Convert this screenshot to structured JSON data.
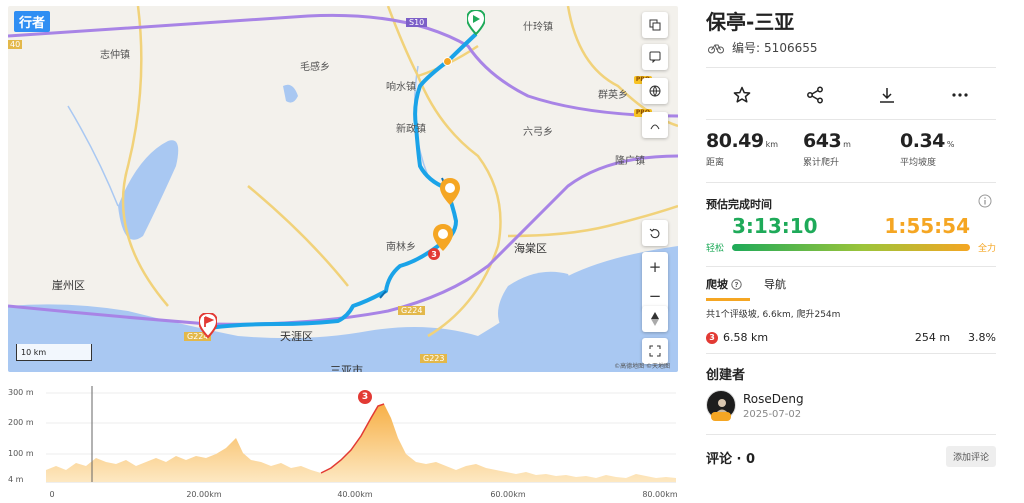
{
  "map": {
    "brand": "行者",
    "places": [
      {
        "name": "志仲镇"
      },
      {
        "name": "毛感乡"
      },
      {
        "name": "响水镇"
      },
      {
        "name": "新政镇"
      },
      {
        "name": "什玲镇"
      },
      {
        "name": "群英乡"
      },
      {
        "name": "六弓乡"
      },
      {
        "name": "隆广镇"
      },
      {
        "name": "南林乡"
      },
      {
        "name": "海棠区"
      },
      {
        "name": "崖州区"
      },
      {
        "name": "天涯区"
      },
      {
        "name": "三亚市"
      }
    ],
    "roads": [
      "S10",
      "G224",
      "G223",
      "G224",
      "40"
    ],
    "scale": "10 km",
    "copyright": "©高德地图 ©天地图",
    "controls": {
      "layers": "layers-icon",
      "feedback": "feedback-icon",
      "globe": "globe-icon",
      "terrain": "terrain-icon",
      "reset": "reset-icon",
      "zoom_in": "+",
      "zoom_out": "−",
      "compass": "compass-icon",
      "fullscreen": "fullscreen-icon"
    },
    "pro_label": "PRO"
  },
  "elevation": {
    "yticks": [
      "300 m",
      "200 m",
      "100 m",
      "4 m"
    ],
    "xticks": [
      "0",
      "20.00km",
      "40.00km",
      "60.00km",
      "80.00km"
    ],
    "climb_marker": "3"
  },
  "route": {
    "title": "保亭-三亚",
    "id_label": "编号:",
    "id_value": "5106655",
    "stats": [
      {
        "value": "80.49",
        "unit": "km",
        "label": "距离"
      },
      {
        "value": "643",
        "unit": "m",
        "label": "累计爬升"
      },
      {
        "value": "0.34",
        "unit": "%",
        "label": "平均坡度"
      }
    ],
    "eta_title": "预估完成时间",
    "eta_easy": "3:13:10",
    "eta_hard": "1:55:54",
    "easy_label": "轻松",
    "hard_label": "全力",
    "tabs": [
      "爬坡",
      "导航"
    ],
    "climb_summary": "共1个评级坡, 6.6km, 爬升254m",
    "climb": {
      "rank": "3",
      "distance": "6.58 km",
      "gain": "254 m",
      "grade": "3.8%"
    },
    "creator_title": "创建者",
    "creator_name": "RoseDeng",
    "creator_date": "2025-07-02",
    "comments_label": "评论 · 0",
    "add_comment": "添加评论"
  },
  "colors": {
    "route": "#1aa3e8",
    "accent": "#f5a623",
    "easy": "#1eaa59",
    "climb": "#e23a34",
    "water": "#a9c8f2"
  }
}
